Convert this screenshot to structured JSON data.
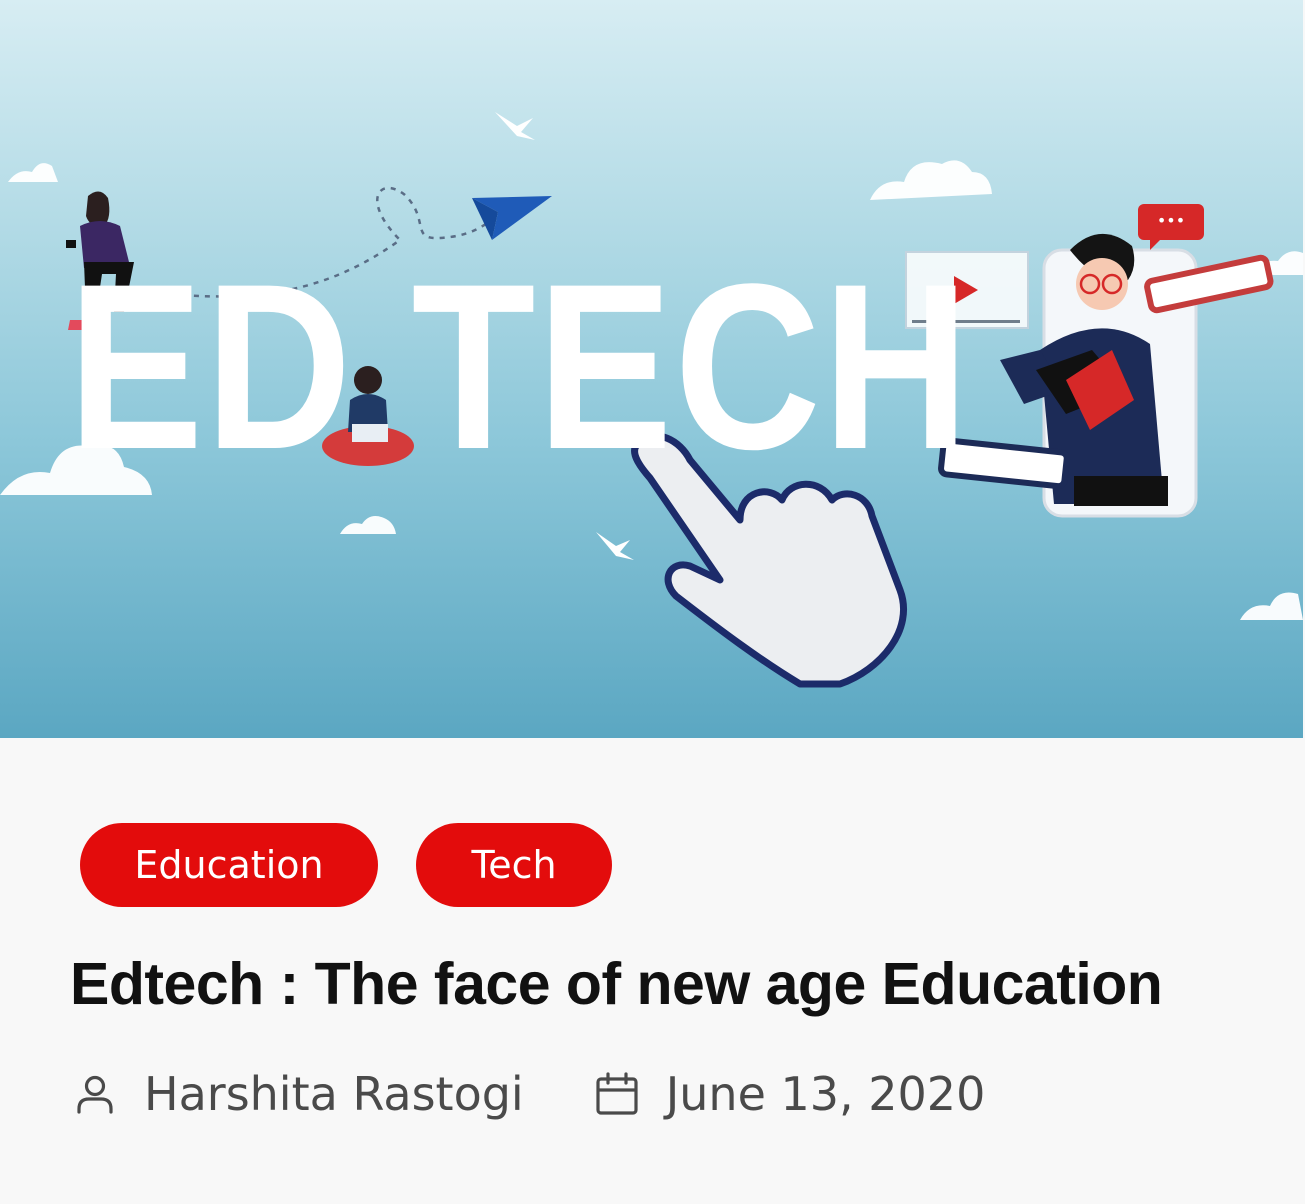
{
  "hero": {
    "word": "ED TECH",
    "chat_dots": "•••",
    "icon": "edtech-illustration"
  },
  "tags": [
    {
      "label": "Education"
    },
    {
      "label": "Tech"
    }
  ],
  "post": {
    "title": "Edtech : The face of new age Education",
    "author": "Harshita Rastogi",
    "date": "June 13, 2020"
  },
  "icons": {
    "author": "user-icon",
    "date": "calendar-icon"
  },
  "colors": {
    "accent": "#e30c0c",
    "title": "#111111",
    "meta": "#4a4a4a",
    "background": "#f8f8f8"
  }
}
